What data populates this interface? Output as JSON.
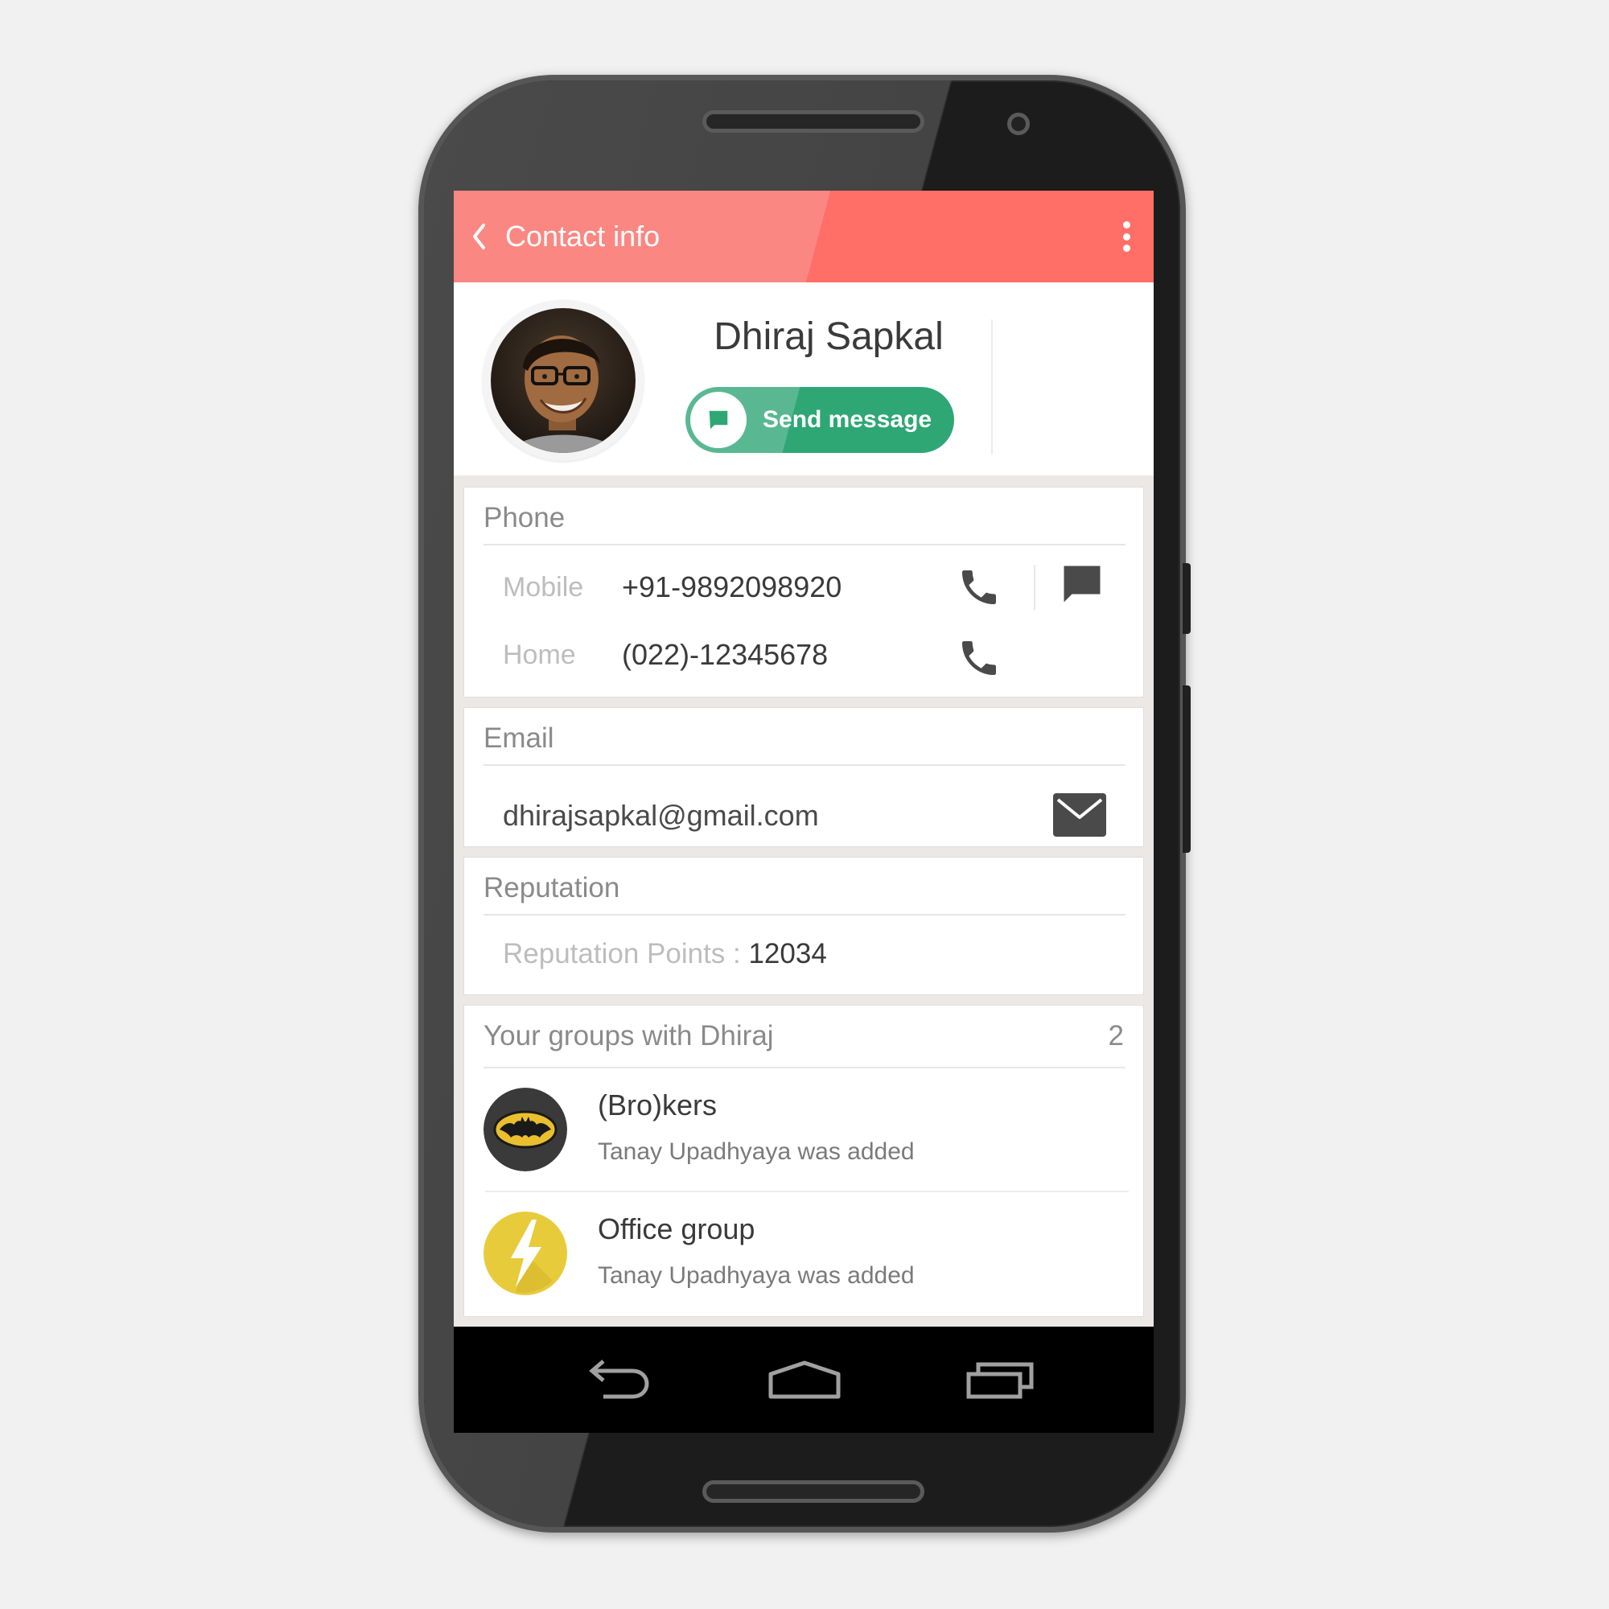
{
  "appbar": {
    "title": "Contact info",
    "color_left": "#fb8782",
    "color_right": "#ff6f67"
  },
  "profile": {
    "name": "Dhiraj Sapkal",
    "send_message_label": "Send message",
    "send_message_color": "#2ea775"
  },
  "phone_section": {
    "title": "Phone",
    "rows": [
      {
        "label": "Mobile",
        "value": "+91-9892098920"
      },
      {
        "label": "Home",
        "value": "(022)-12345678"
      }
    ]
  },
  "email_section": {
    "title": "Email",
    "value": "dhirajsapkal@gmail.com"
  },
  "reputation_section": {
    "title": "Reputation",
    "label": "Reputation Points : ",
    "value": "12034"
  },
  "groups_section": {
    "title": "Your groups with Dhiraj",
    "count": "2",
    "groups": [
      {
        "name": "(Bro)kers",
        "subtitle": "Tanay Upadhyaya was added",
        "icon": "batman-logo-icon"
      },
      {
        "name": "Office group",
        "subtitle": "Tanay Upadhyaya was added",
        "icon": "lightning-bolt-icon"
      }
    ]
  },
  "navbar": {
    "buttons": [
      "back-icon",
      "home-icon",
      "recents-icon"
    ]
  },
  "icons": {
    "back": "chevron-left-icon",
    "overflow": "more-vert-icon",
    "call": "phone-icon",
    "message": "chat-bubble-icon",
    "email": "envelope-icon"
  }
}
